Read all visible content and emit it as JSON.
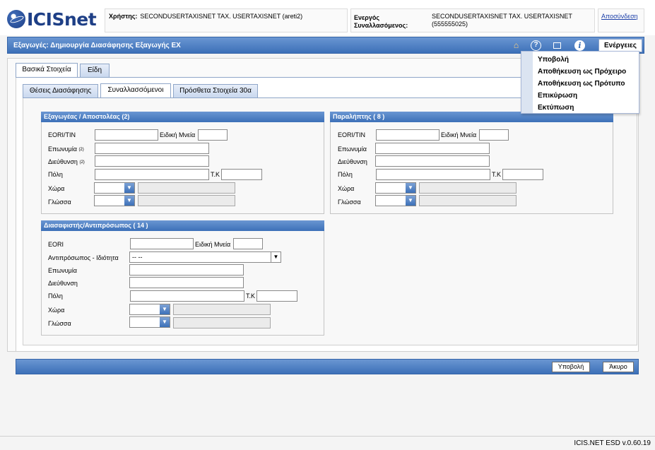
{
  "brand": {
    "logo_text": "ICISnet"
  },
  "header": {
    "user_label": "Χρήστης:",
    "user_value": "SECONDUSERTAXISNET TAX. USERTAXISNET (areti2)",
    "trader_label": "Ενεργός Συναλλασόμενος:",
    "trader_value": "SECONDUSERTAXISNET TAX. USERTAXISNET (555555025)",
    "logout": "Αποσύνδεση"
  },
  "titlebar": {
    "title": "Εξαγωγές: Δημιουργία Διασάφησης Εξαγωγής EX",
    "icons": [
      "home-icon",
      "help-icon",
      "window-icon",
      "info-icon"
    ],
    "actions_button": "Ενέργειες"
  },
  "actions_menu": {
    "items": [
      "Υποβολή",
      "Αποθήκευση ως Πρόχειρο",
      "Αποθήκευση ως Πρότυπο",
      "Επικύρωση",
      "Εκτύπωση"
    ]
  },
  "tabs": {
    "main": [
      "Βασικά Στοιχεία",
      "Είδη"
    ],
    "main_active": "Βασικά Στοιχεία"
  },
  "subtabs": {
    "items": [
      "Θέσεις Διασάφησης",
      "Συναλλασσόμενοι",
      "Πρόσθετα Στοιχεία 30α"
    ],
    "active": "Συναλλασσόμενοι"
  },
  "exporter": {
    "header": "Εξαγωγέας / Αποστολέας (2)",
    "eori_label": "EORI/TIN",
    "special_label": "Ειδική Μνεία",
    "name_label": "Επωνυμία",
    "name_note": "(2)",
    "address_label": "Διεύθυνση",
    "address_note": "(2)",
    "city_label": "Πόλη",
    "zip_label": "Τ.Κ",
    "country_label": "Χώρα",
    "language_label": "Γλώσσα"
  },
  "consignee": {
    "header": "Παραλήπτης ( 8 )",
    "eori_label": "EORI/TIN",
    "special_label": "Ειδική Μνεία",
    "name_label": "Επωνυμία",
    "address_label": "Διεύθυνση",
    "city_label": "Πόλη",
    "zip_label": "Τ.Κ",
    "country_label": "Χώρα",
    "language_label": "Γλώσσα"
  },
  "declarant": {
    "header": "Διασαφιστής/Αντιπρόσωπος ( 14 )",
    "eori_label": "EORI",
    "special_label": "Ειδική Μνεία",
    "rep_label": "Αντιπρόσωπος - Ιδιότητα",
    "rep_value": "-- --",
    "name_label": "Επωνυμία",
    "address_label": "Διεύθυνση",
    "city_label": "Πόλη",
    "zip_label": "Τ.Κ",
    "country_label": "Χώρα",
    "language_label": "Γλώσσα"
  },
  "bottom": {
    "submit": "Υποβολή",
    "cancel": "Άκυρο"
  },
  "footer": {
    "version": "ICIS.NET ESD v.0.60.19"
  }
}
